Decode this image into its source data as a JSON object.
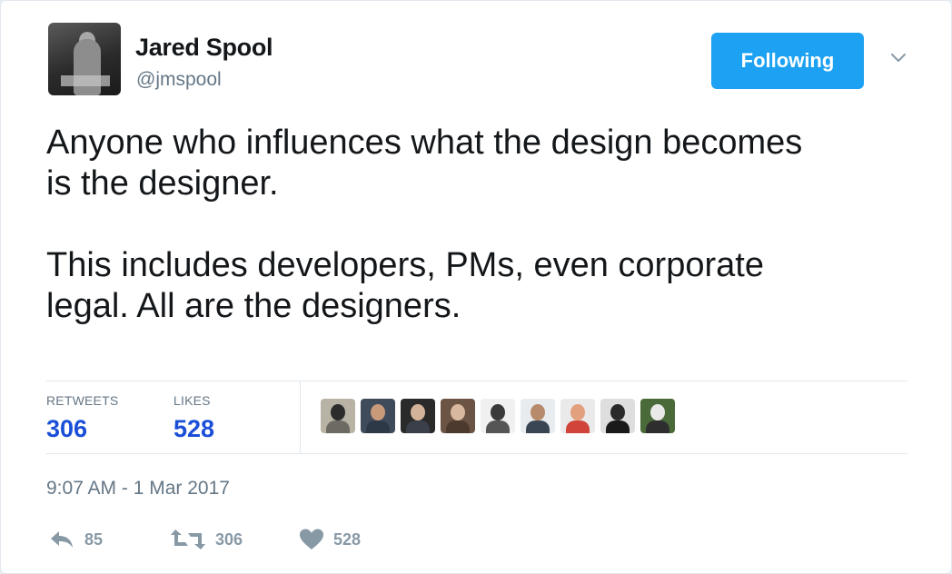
{
  "author": {
    "display_name": "Jared Spool",
    "handle": "@jmspool"
  },
  "follow_button": {
    "label": "Following"
  },
  "menu": {
    "icon": "chevron-down-icon"
  },
  "tweet": {
    "paragraphs": [
      "Anyone who influences what the design becomes\nis the designer.",
      "This includes developers, PMs, even corporate\nlegal. All are the designers."
    ]
  },
  "stats": {
    "retweets_label": "RETWEETS",
    "retweets_value": "306",
    "likes_label": "LIKES",
    "likes_value": "528"
  },
  "liker_avatars": [
    {
      "name": "liker-1",
      "bg": "#b9b3a6",
      "face": "#2c2c2c",
      "body": "#6d6a64"
    },
    {
      "name": "liker-2",
      "bg": "#3f4a5a",
      "face": "#c89a7a",
      "body": "#2e3948"
    },
    {
      "name": "liker-3",
      "bg": "#2a2a2a",
      "face": "#d3b49a",
      "body": "#3a3f4a"
    },
    {
      "name": "liker-4",
      "bg": "#6b5443",
      "face": "#d9b8a0",
      "body": "#4c3a2e"
    },
    {
      "name": "liker-5",
      "bg": "#f0f0f0",
      "face": "#3a3a3a",
      "body": "#555555"
    },
    {
      "name": "liker-6",
      "bg": "#e8ecef",
      "face": "#b88a6c",
      "body": "#3a4654"
    },
    {
      "name": "liker-7",
      "bg": "#eaeaea",
      "face": "#e2a07e",
      "body": "#d1443a"
    },
    {
      "name": "liker-8",
      "bg": "#dedede",
      "face": "#2a2a2a",
      "body": "#1a1a1a"
    },
    {
      "name": "liker-9",
      "bg": "#4a6a3a",
      "face": "#e9e9e9",
      "body": "#2e2e2e"
    }
  ],
  "timestamp": "9:07 AM - 1 Mar 2017",
  "actions": {
    "reply_count": "85",
    "retweet_count": "306",
    "like_count": "528"
  },
  "colors": {
    "accent": "#1da1f2",
    "stat_number": "#1b4fd8",
    "muted": "#657786",
    "action_icon": "#8899a6"
  }
}
